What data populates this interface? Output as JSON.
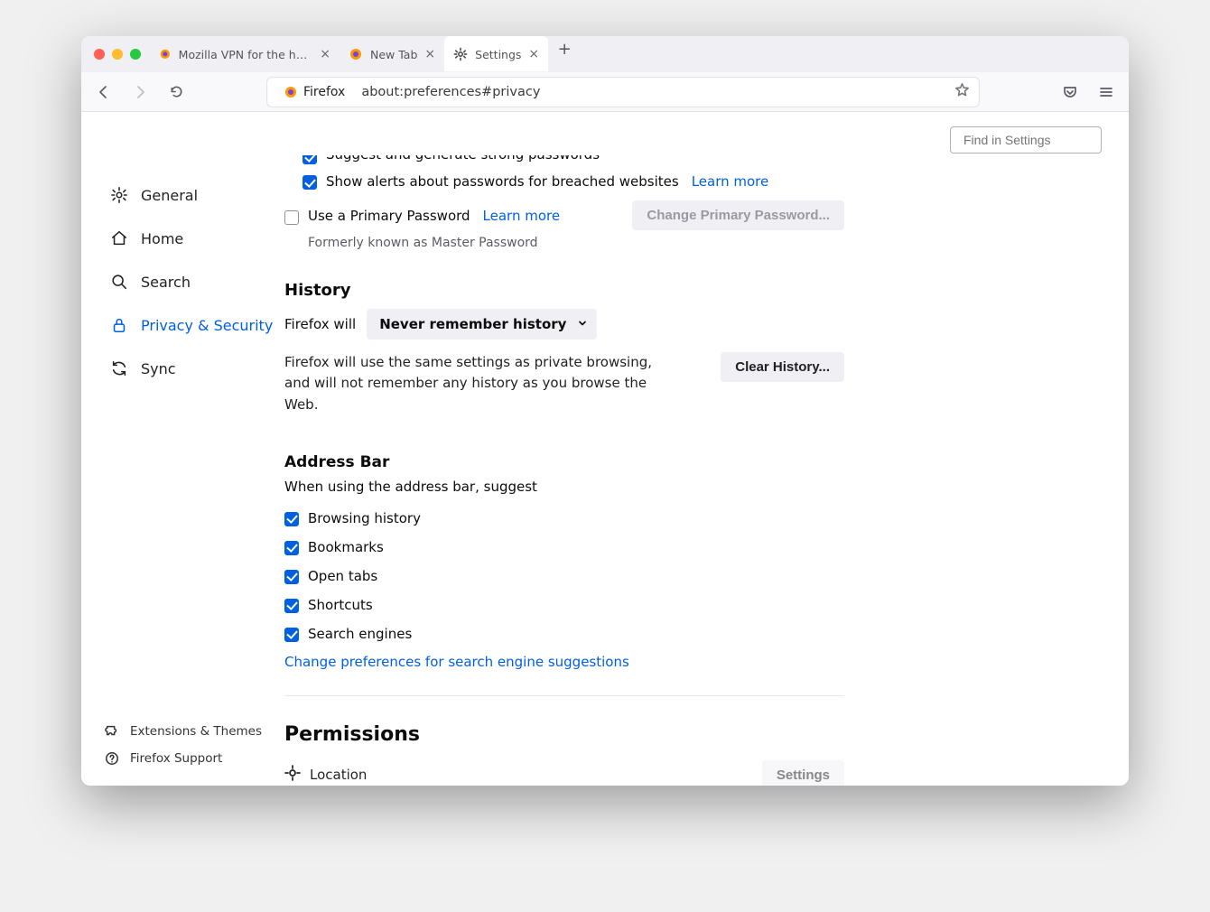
{
  "tabs": [
    {
      "label": "Mozilla VPN for the holidays",
      "active": false
    },
    {
      "label": "New Tab",
      "active": false
    },
    {
      "label": "Settings",
      "active": true
    }
  ],
  "toolbar": {
    "address_label": "Firefox",
    "address_url": "about:preferences#privacy"
  },
  "search": {
    "placeholder": "Find in Settings"
  },
  "sidebar": {
    "items": [
      {
        "label": "General"
      },
      {
        "label": "Home"
      },
      {
        "label": "Search"
      },
      {
        "label": "Privacy & Security"
      },
      {
        "label": "Sync"
      }
    ],
    "bottom": {
      "ext": "Extensions & Themes",
      "support": "Firefox Support"
    }
  },
  "passwords": {
    "suggest_label": "Suggest and generate strong passwords",
    "alerts_label": "Show alerts about passwords for breached websites",
    "alerts_learn": "Learn more",
    "primary_label": "Use a Primary Password",
    "primary_learn": "Learn more",
    "change_btn": "Change Primary Password...",
    "formerly": "Formerly known as Master Password"
  },
  "history": {
    "heading": "History",
    "firefox_will": "Firefox will",
    "select_value": "Never remember history",
    "description": "Firefox will use the same settings as private browsing, and will not remember any history as you browse the Web.",
    "clear_btn": "Clear History..."
  },
  "addressbar": {
    "heading": "Address Bar",
    "subtitle": "When using the address bar, suggest",
    "items": [
      {
        "label": "Browsing history",
        "checked": true
      },
      {
        "label": "Bookmarks",
        "checked": true
      },
      {
        "label": "Open tabs",
        "checked": true
      },
      {
        "label": "Shortcuts",
        "checked": true
      },
      {
        "label": "Search engines",
        "checked": true
      }
    ],
    "change_prefs": "Change preferences for search engine suggestions"
  },
  "permissions": {
    "heading": "Permissions",
    "location_label": "Location",
    "settings_btn": "Settings"
  }
}
